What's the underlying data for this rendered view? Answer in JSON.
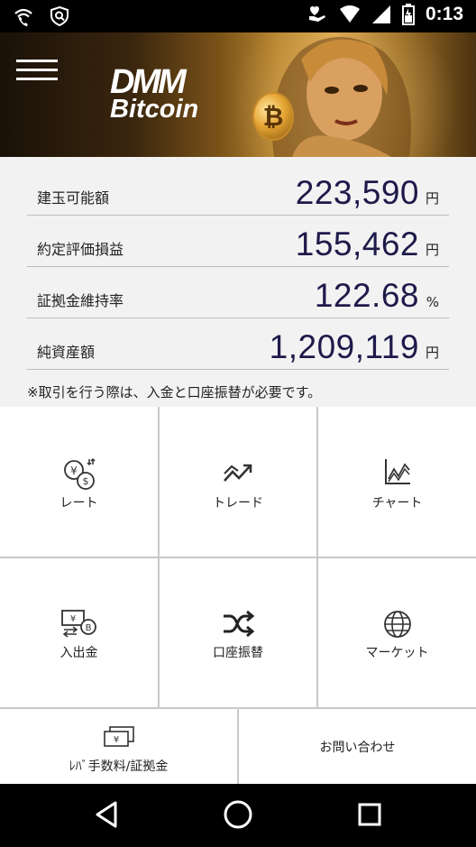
{
  "status_bar": {
    "time": "0:13",
    "icons": [
      "wifi-calling-icon",
      "shield-search-icon",
      "heart-hand-icon",
      "wifi-icon",
      "cell-signal-icon",
      "battery-icon"
    ]
  },
  "header": {
    "menu_icon": "hamburger-icon",
    "brand_line1": "DMM",
    "brand_line2": "Bitcoin",
    "coin_symbol": "₿"
  },
  "summary": {
    "rows": [
      {
        "label": "建玉可能額",
        "value": "223,590",
        "unit": "円"
      },
      {
        "label": "約定評価損益",
        "value": "155,462",
        "unit": "円"
      },
      {
        "label": "証拠金維持率",
        "value": "122.68",
        "unit": "%"
      },
      {
        "label": "純資産額",
        "value": "1,209,119",
        "unit": "円"
      }
    ],
    "note": "※取引を行う際は、入金と口座振替が必要です。"
  },
  "menu": {
    "items": [
      {
        "label": "レート",
        "icon": "yen-dollar-exchange-icon"
      },
      {
        "label": "トレード",
        "icon": "trend-chart-icon"
      },
      {
        "label": "チャート",
        "icon": "line-chart-icon"
      },
      {
        "label": "入出金",
        "icon": "deposit-withdraw-icon"
      },
      {
        "label": "口座振替",
        "icon": "shuffle-icon"
      },
      {
        "label": "マーケット",
        "icon": "globe-icon"
      },
      {
        "label": "ﾚﾊﾞ手数料/証拠金",
        "icon": "yen-bills-icon"
      },
      {
        "label": "お問い合わせ",
        "icon": ""
      }
    ]
  },
  "navbar": {
    "buttons": [
      "back-icon",
      "home-icon",
      "recents-icon"
    ]
  },
  "colors": {
    "value_text": "#1e1a4a",
    "banner_gold": "#b5832e",
    "summary_bg": "#f2f2f2"
  }
}
